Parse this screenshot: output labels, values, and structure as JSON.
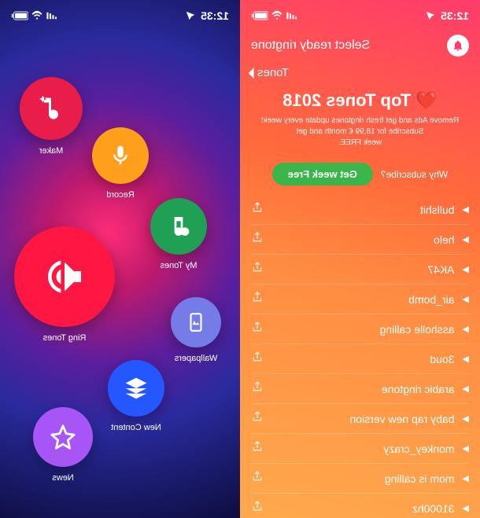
{
  "status": {
    "time": "12:35",
    "location_indicator": "location-arrow"
  },
  "left": {
    "nav_title": "Select ready ringtone",
    "back_label": "Tones",
    "hero_emoji": "❤️",
    "hero_title": "Top Tones 2018",
    "hero_sub_line1": "Remove Ads and get fresh ringtones update every week!",
    "hero_sub_line2": "Subscribe for 18,99 € month and get",
    "hero_sub_line3": "week FREE.",
    "subscribe_prompt": "Why subscribe?",
    "cta_label": "Get week Free",
    "tones": [
      "bullshit",
      "helo",
      "AK47",
      "air_bomb",
      "assholle calling",
      "3oud",
      "arabic ringtone",
      "baby rap new version",
      "monkey_crazy",
      "mom is calling",
      "31000hz"
    ]
  },
  "right": {
    "bubbles": {
      "maker": "Maker",
      "record": "Record",
      "mytones": "My Tones",
      "ringtones": "Ring Tones",
      "wallpapers": "Wallpapers",
      "newcontent": "New Content",
      "news": "News"
    }
  }
}
